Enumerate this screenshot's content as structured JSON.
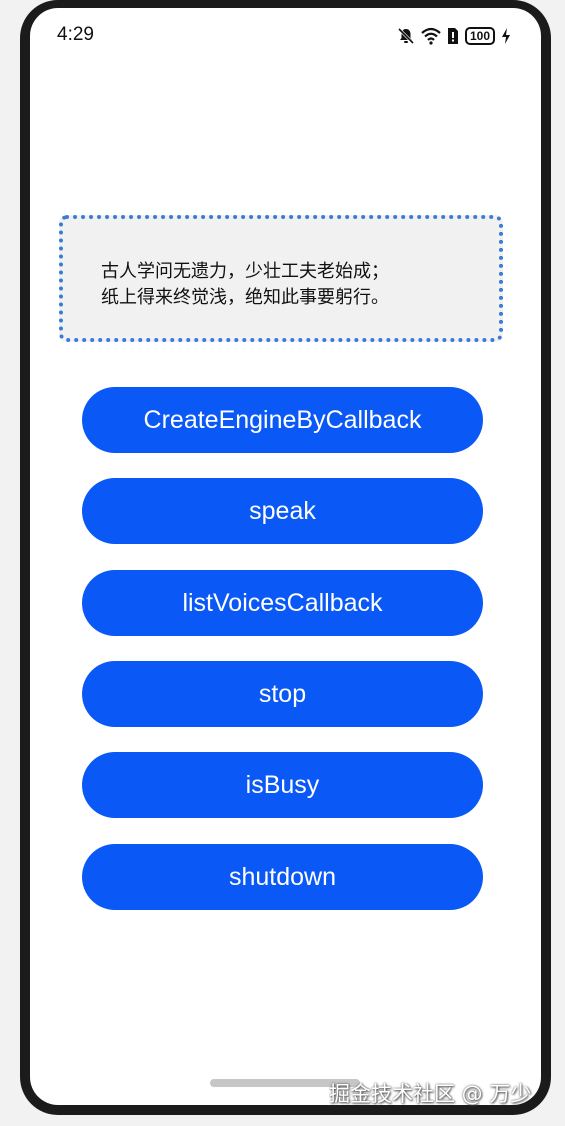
{
  "status_bar": {
    "time": "4:29",
    "battery_level": "100",
    "icons": [
      "bell-off-icon",
      "wifi-icon",
      "sim-icon",
      "battery-icon",
      "charging-icon"
    ]
  },
  "poem": {
    "line1": "古人学问无遗力，少壮工夫老始成；",
    "line2": "纸上得来终觉浅，绝知此事要躬行。"
  },
  "buttons": [
    {
      "label": "CreateEngineByCallback"
    },
    {
      "label": "speak"
    },
    {
      "label": "listVoicesCallback"
    },
    {
      "label": "stop"
    },
    {
      "label": "isBusy"
    },
    {
      "label": "shutdown"
    }
  ],
  "watermark": "掘金技术社区 @ 万少",
  "colors": {
    "button": "#0a59f7",
    "poem_border": "#3a7bd5",
    "poem_background": "#f1f1f1"
  }
}
